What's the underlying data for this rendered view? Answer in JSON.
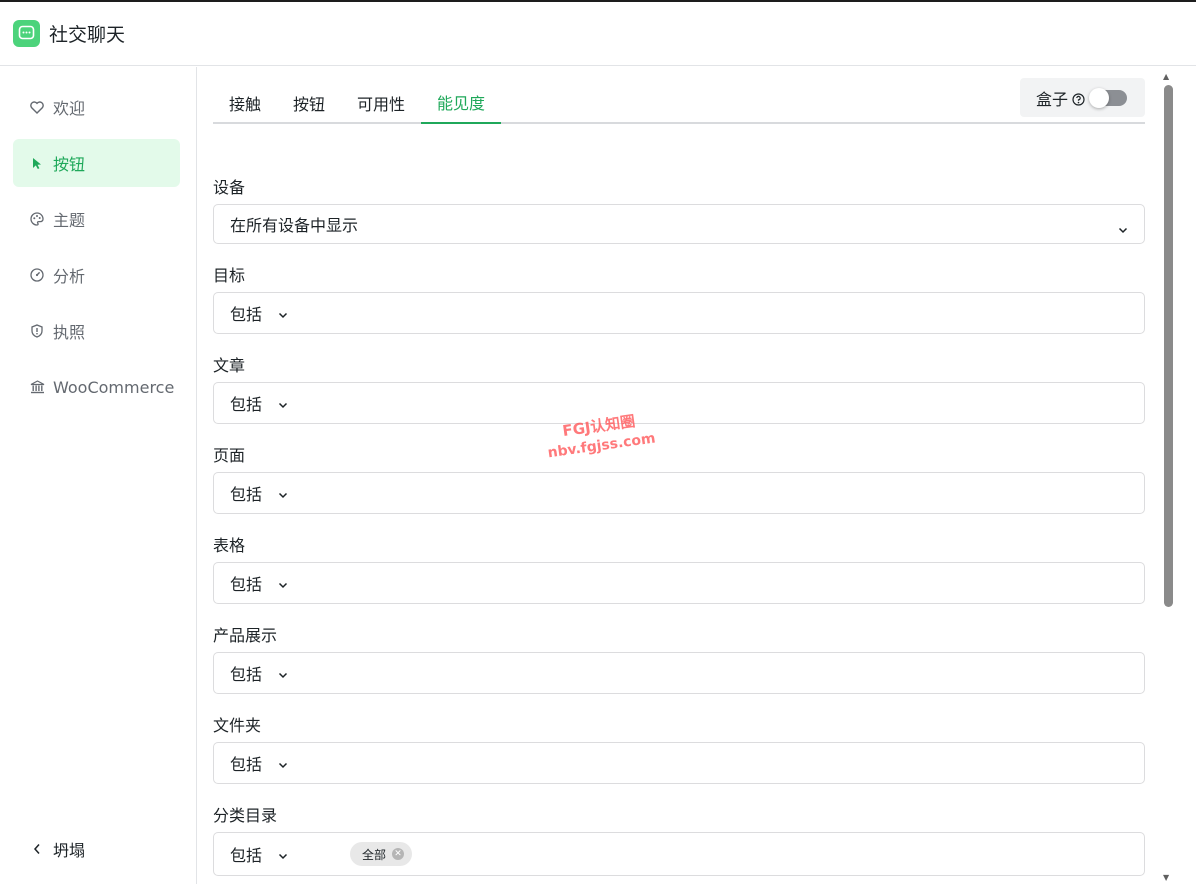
{
  "app": {
    "title": "社交聊天"
  },
  "sidebar": {
    "items": [
      {
        "label": "欢迎",
        "icon": "heart-icon"
      },
      {
        "label": "按钮",
        "icon": "cursor-icon",
        "active": true
      },
      {
        "label": "主题",
        "icon": "palette-icon"
      },
      {
        "label": "分析",
        "icon": "gauge-icon"
      },
      {
        "label": "执照",
        "icon": "shield-icon"
      },
      {
        "label": "WooCommerce",
        "icon": "bank-icon"
      }
    ],
    "collapse_label": "坍塌"
  },
  "tabs": [
    {
      "label": "接触"
    },
    {
      "label": "按钮"
    },
    {
      "label": "可用性"
    },
    {
      "label": "能见度",
      "active": true
    }
  ],
  "box_toggle": {
    "label": "盒子",
    "enabled": false
  },
  "fields": {
    "devices": {
      "label": "设备",
      "value": "在所有设备中显示"
    },
    "targets": {
      "label": "目标",
      "mode": "包括"
    },
    "posts": {
      "label": "文章",
      "mode": "包括"
    },
    "pages": {
      "label": "页面",
      "mode": "包括"
    },
    "forms": {
      "label": "表格",
      "mode": "包括"
    },
    "products": {
      "label": "产品展示",
      "mode": "包括"
    },
    "folders": {
      "label": "文件夹",
      "mode": "包括"
    },
    "categories": {
      "label": "分类目录",
      "mode": "包括",
      "tag": "全部"
    }
  },
  "watermark": {
    "line1": "FGJ认知圈",
    "line2": "nbv.fgjss.com"
  },
  "colors": {
    "accent": "#1fa85a",
    "active_bg": "#e3faea",
    "logo": "#4cd37b"
  }
}
